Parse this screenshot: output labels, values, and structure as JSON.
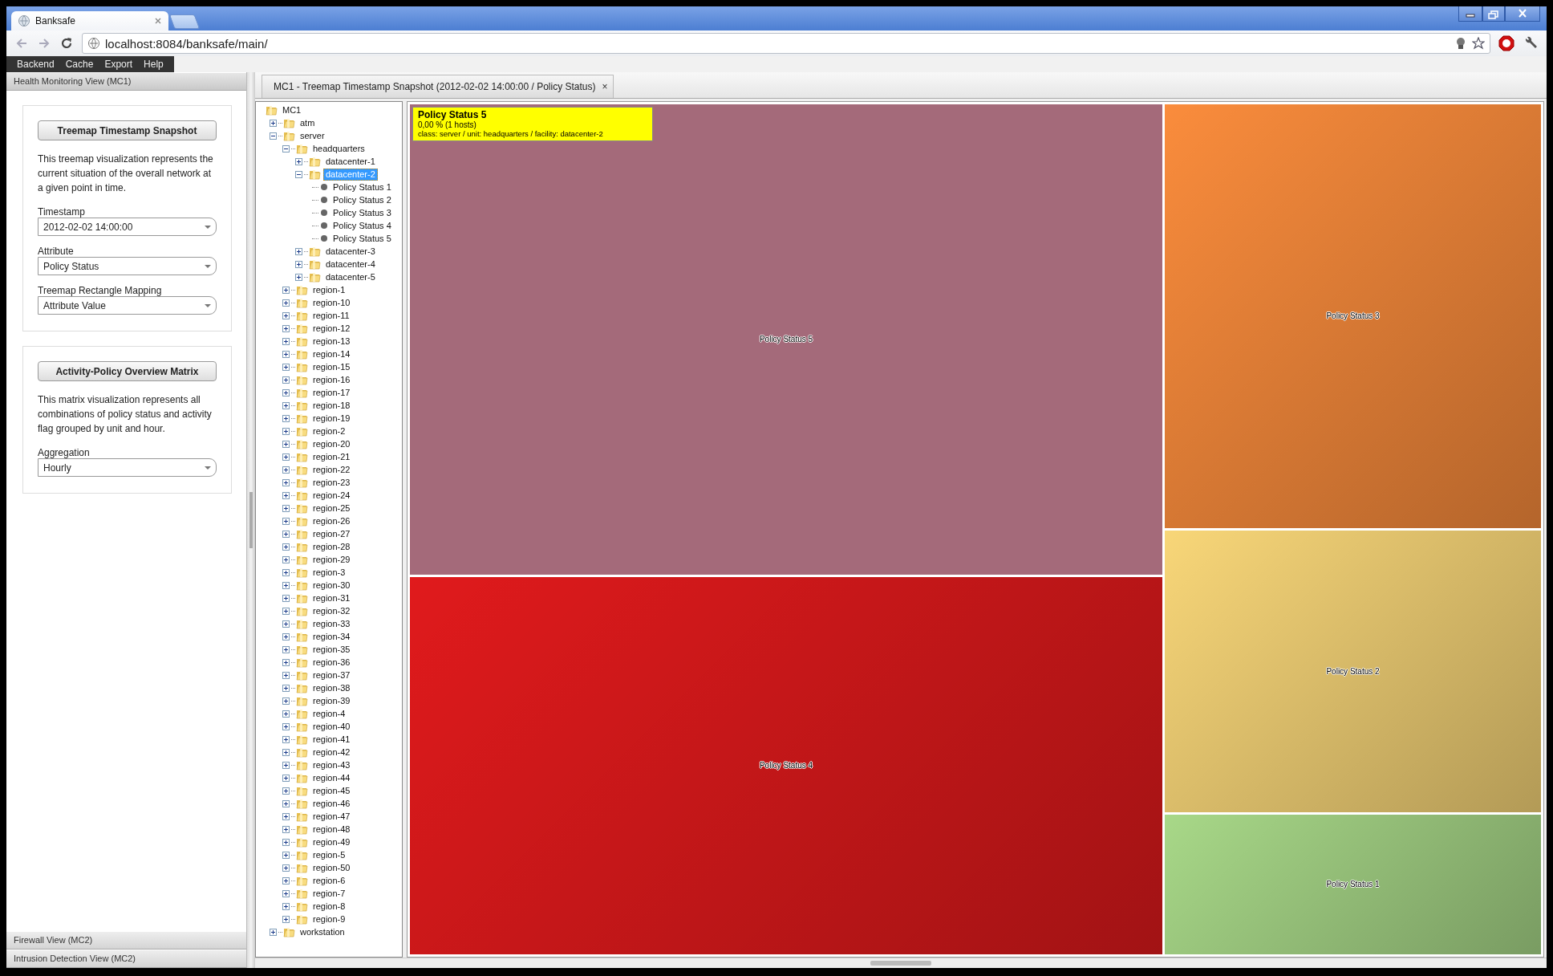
{
  "browser": {
    "tab_title": "Banksafe",
    "url": "localhost:8084/banksafe/main/"
  },
  "menu": [
    "Backend",
    "Cache",
    "Export",
    "Help"
  ],
  "sidebar": {
    "open_section": "Health Monitoring View (MC1)",
    "collapsed_sections": [
      "Firewall View (MC2)",
      "Intrusion Detection View (MC2)"
    ],
    "cards": [
      {
        "button": "Treemap Timestamp Snapshot",
        "description": "This treemap visualization represents the current situation of the overall network at a given point in time.",
        "fields": [
          {
            "label": "Timestamp",
            "value": "2012-02-02 14:00:00"
          },
          {
            "label": "Attribute",
            "value": "Policy Status"
          },
          {
            "label": "Treemap Rectangle Mapping",
            "value": "Attribute Value"
          }
        ]
      },
      {
        "button": "Activity-Policy Overview Matrix",
        "description": "This matrix visualization represents all combinations of policy status and activity flag grouped by unit and hour.",
        "fields": [
          {
            "label": "Aggregation",
            "value": "Hourly"
          }
        ]
      }
    ]
  },
  "view_tab": {
    "title": "MC1 - Treemap Timestamp Snapshot (2012-02-02 14:00:00 / Policy Status)",
    "close": "×"
  },
  "tree": {
    "label": "MC1",
    "kind": "folder",
    "selected": false,
    "children": [
      {
        "label": "atm",
        "kind": "folder",
        "expanded": false,
        "selected": false
      },
      {
        "label": "server",
        "kind": "folder",
        "expanded": true,
        "selected": false,
        "children": [
          {
            "label": "headquarters",
            "kind": "folder",
            "expanded": true,
            "selected": false,
            "children": [
              {
                "label": "datacenter-1",
                "kind": "folder",
                "expanded": false,
                "selected": false
              },
              {
                "label": "datacenter-2",
                "kind": "folder",
                "expanded": true,
                "selected": true,
                "children": [
                  {
                    "label": "Policy Status 1",
                    "kind": "leaf",
                    "selected": false
                  },
                  {
                    "label": "Policy Status 2",
                    "kind": "leaf",
                    "selected": false
                  },
                  {
                    "label": "Policy Status 3",
                    "kind": "leaf",
                    "selected": false
                  },
                  {
                    "label": "Policy Status 4",
                    "kind": "leaf",
                    "selected": false
                  },
                  {
                    "label": "Policy Status 5",
                    "kind": "leaf",
                    "selected": false
                  }
                ]
              },
              {
                "label": "datacenter-3",
                "kind": "folder",
                "expanded": false,
                "selected": false
              },
              {
                "label": "datacenter-4",
                "kind": "folder",
                "expanded": false,
                "selected": false
              },
              {
                "label": "datacenter-5",
                "kind": "folder",
                "expanded": false,
                "selected": false
              }
            ]
          },
          {
            "label": "region-1",
            "kind": "folder",
            "expanded": false,
            "selected": false
          },
          {
            "label": "region-10",
            "kind": "folder",
            "expanded": false,
            "selected": false
          },
          {
            "label": "region-11",
            "kind": "folder",
            "expanded": false,
            "selected": false
          },
          {
            "label": "region-12",
            "kind": "folder",
            "expanded": false,
            "selected": false
          },
          {
            "label": "region-13",
            "kind": "folder",
            "expanded": false,
            "selected": false
          },
          {
            "label": "region-14",
            "kind": "folder",
            "expanded": false,
            "selected": false
          },
          {
            "label": "region-15",
            "kind": "folder",
            "expanded": false,
            "selected": false
          },
          {
            "label": "region-16",
            "kind": "folder",
            "expanded": false,
            "selected": false
          },
          {
            "label": "region-17",
            "kind": "folder",
            "expanded": false,
            "selected": false
          },
          {
            "label": "region-18",
            "kind": "folder",
            "expanded": false,
            "selected": false
          },
          {
            "label": "region-19",
            "kind": "folder",
            "expanded": false,
            "selected": false
          },
          {
            "label": "region-2",
            "kind": "folder",
            "expanded": false,
            "selected": false
          },
          {
            "label": "region-20",
            "kind": "folder",
            "expanded": false,
            "selected": false
          },
          {
            "label": "region-21",
            "kind": "folder",
            "expanded": false,
            "selected": false
          },
          {
            "label": "region-22",
            "kind": "folder",
            "expanded": false,
            "selected": false
          },
          {
            "label": "region-23",
            "kind": "folder",
            "expanded": false,
            "selected": false
          },
          {
            "label": "region-24",
            "kind": "folder",
            "expanded": false,
            "selected": false
          },
          {
            "label": "region-25",
            "kind": "folder",
            "expanded": false,
            "selected": false
          },
          {
            "label": "region-26",
            "kind": "folder",
            "expanded": false,
            "selected": false
          },
          {
            "label": "region-27",
            "kind": "folder",
            "expanded": false,
            "selected": false
          },
          {
            "label": "region-28",
            "kind": "folder",
            "expanded": false,
            "selected": false
          },
          {
            "label": "region-29",
            "kind": "folder",
            "expanded": false,
            "selected": false
          },
          {
            "label": "region-3",
            "kind": "folder",
            "expanded": false,
            "selected": false
          },
          {
            "label": "region-30",
            "kind": "folder",
            "expanded": false,
            "selected": false
          },
          {
            "label": "region-31",
            "kind": "folder",
            "expanded": false,
            "selected": false
          },
          {
            "label": "region-32",
            "kind": "folder",
            "expanded": false,
            "selected": false
          },
          {
            "label": "region-33",
            "kind": "folder",
            "expanded": false,
            "selected": false
          },
          {
            "label": "region-34",
            "kind": "folder",
            "expanded": false,
            "selected": false
          },
          {
            "label": "region-35",
            "kind": "folder",
            "expanded": false,
            "selected": false
          },
          {
            "label": "region-36",
            "kind": "folder",
            "expanded": false,
            "selected": false
          },
          {
            "label": "region-37",
            "kind": "folder",
            "expanded": false,
            "selected": false
          },
          {
            "label": "region-38",
            "kind": "folder",
            "expanded": false,
            "selected": false
          },
          {
            "label": "region-39",
            "kind": "folder",
            "expanded": false,
            "selected": false
          },
          {
            "label": "region-4",
            "kind": "folder",
            "expanded": false,
            "selected": false
          },
          {
            "label": "region-40",
            "kind": "folder",
            "expanded": false,
            "selected": false
          },
          {
            "label": "region-41",
            "kind": "folder",
            "expanded": false,
            "selected": false
          },
          {
            "label": "region-42",
            "kind": "folder",
            "expanded": false,
            "selected": false
          },
          {
            "label": "region-43",
            "kind": "folder",
            "expanded": false,
            "selected": false
          },
          {
            "label": "region-44",
            "kind": "folder",
            "expanded": false,
            "selected": false
          },
          {
            "label": "region-45",
            "kind": "folder",
            "expanded": false,
            "selected": false
          },
          {
            "label": "region-46",
            "kind": "folder",
            "expanded": false,
            "selected": false
          },
          {
            "label": "region-47",
            "kind": "folder",
            "expanded": false,
            "selected": false
          },
          {
            "label": "region-48",
            "kind": "folder",
            "expanded": false,
            "selected": false
          },
          {
            "label": "region-49",
            "kind": "folder",
            "expanded": false,
            "selected": false
          },
          {
            "label": "region-5",
            "kind": "folder",
            "expanded": false,
            "selected": false
          },
          {
            "label": "region-50",
            "kind": "folder",
            "expanded": false,
            "selected": false
          },
          {
            "label": "region-6",
            "kind": "folder",
            "expanded": false,
            "selected": false
          },
          {
            "label": "region-7",
            "kind": "folder",
            "expanded": false,
            "selected": false
          },
          {
            "label": "region-8",
            "kind": "folder",
            "expanded": false,
            "selected": false
          },
          {
            "label": "region-9",
            "kind": "folder",
            "expanded": false,
            "selected": false
          }
        ]
      },
      {
        "label": "workstation",
        "kind": "folder",
        "expanded": false,
        "selected": false
      }
    ]
  },
  "treemap": {
    "tooltip": {
      "title": "Policy Status 5",
      "value": "0,00 % (1 hosts)",
      "detail": "class: server / unit: headquarters / facility: datacenter-2"
    },
    "rects": [
      {
        "label": "Policy Status 5",
        "color": "#a46a7a"
      },
      {
        "label": "Policy Status 4",
        "color": "#e01a1c"
      },
      {
        "label": "Policy Status 3",
        "color": "#fa8c3c"
      },
      {
        "label": "Policy Status 2",
        "color": "#f8d678"
      },
      {
        "label": "Policy Status 1",
        "color": "#a8d888"
      }
    ]
  }
}
